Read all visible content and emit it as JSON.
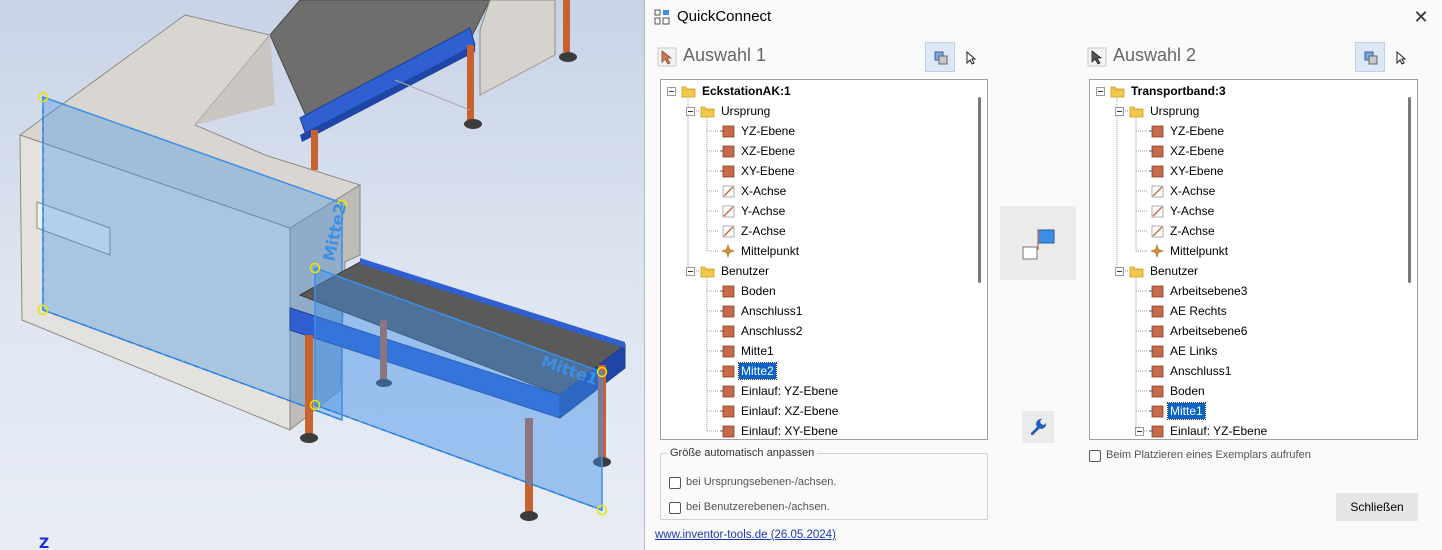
{
  "dialog": {
    "title": "QuickConnect",
    "close_symbol": "✕"
  },
  "viewport": {
    "label_a": "Mitte2",
    "label_b": "Mitte1",
    "axis_label": "Z"
  },
  "left": {
    "heading": "Auswahl 1",
    "tree": [
      {
        "label": "EckstationAK:1",
        "icon": "folder-icon",
        "level": 0,
        "expander": true,
        "bold": true
      },
      {
        "label": "Ursprung",
        "icon": "folder-icon",
        "level": 1,
        "expander": true
      },
      {
        "label": "YZ-Ebene",
        "icon": "plane-icon",
        "level": 2
      },
      {
        "label": "XZ-Ebene",
        "icon": "plane-icon",
        "level": 2
      },
      {
        "label": "XY-Ebene",
        "icon": "plane-icon",
        "level": 2
      },
      {
        "label": "X-Achse",
        "icon": "axis-icon",
        "level": 2
      },
      {
        "label": "Y-Achse",
        "icon": "axis-icon",
        "level": 2
      },
      {
        "label": "Z-Achse",
        "icon": "axis-icon",
        "level": 2
      },
      {
        "label": "Mittelpunkt",
        "icon": "point-icon",
        "level": 2
      },
      {
        "label": "Benutzer",
        "icon": "folder-icon",
        "level": 1,
        "expander": true
      },
      {
        "label": "Boden",
        "icon": "plane-icon",
        "level": 2
      },
      {
        "label": "Anschluss1",
        "icon": "plane-icon",
        "level": 2
      },
      {
        "label": "Anschluss2",
        "icon": "plane-icon",
        "level": 2
      },
      {
        "label": "Mitte1",
        "icon": "plane-icon",
        "level": 2
      },
      {
        "label": "Mitte2",
        "icon": "plane-icon",
        "level": 2,
        "selected": true
      },
      {
        "label": "Einlauf: YZ-Ebene",
        "icon": "plane-icon",
        "level": 2
      },
      {
        "label": "Einlauf: XZ-Ebene",
        "icon": "plane-icon",
        "level": 2
      },
      {
        "label": "Einlauf: XY-Ebene",
        "icon": "plane-icon",
        "level": 2
      }
    ]
  },
  "right": {
    "heading": "Auswahl 2",
    "tree": [
      {
        "label": "Transportband:3",
        "icon": "folder-icon",
        "level": 0,
        "expander": true,
        "bold": true
      },
      {
        "label": "Ursprung",
        "icon": "folder-icon",
        "level": 1,
        "expander": true
      },
      {
        "label": "YZ-Ebene",
        "icon": "plane-icon",
        "level": 2
      },
      {
        "label": "XZ-Ebene",
        "icon": "plane-icon",
        "level": 2
      },
      {
        "label": "XY-Ebene",
        "icon": "plane-icon",
        "level": 2
      },
      {
        "label": "X-Achse",
        "icon": "axis-icon",
        "level": 2
      },
      {
        "label": "Y-Achse",
        "icon": "axis-icon",
        "level": 2
      },
      {
        "label": "Z-Achse",
        "icon": "axis-icon",
        "level": 2
      },
      {
        "label": "Mittelpunkt",
        "icon": "point-icon",
        "level": 2
      },
      {
        "label": "Benutzer",
        "icon": "folder-icon",
        "level": 1,
        "expander": true
      },
      {
        "label": "Arbeitsebene3",
        "icon": "plane-icon",
        "level": 2
      },
      {
        "label": "AE Rechts",
        "icon": "plane-icon",
        "level": 2
      },
      {
        "label": "Arbeitsebene6",
        "icon": "plane-icon",
        "level": 2
      },
      {
        "label": "AE Links",
        "icon": "plane-icon",
        "level": 2
      },
      {
        "label": "Anschluss1",
        "icon": "plane-icon",
        "level": 2
      },
      {
        "label": "Boden",
        "icon": "plane-icon",
        "level": 2
      },
      {
        "label": "Mitte1",
        "icon": "plane-icon",
        "level": 2,
        "selected": true
      },
      {
        "label": "Einlauf: YZ-Ebene",
        "icon": "plane-icon",
        "level": 2,
        "expander": true
      }
    ]
  },
  "auto_size": {
    "legend": "Größe automatisch anpassen",
    "option1": "bei Ursprungsebenen-/achsen.",
    "option2": "bei Benutzerebenen-/achsen."
  },
  "on_place_option": "Beim Platzieren eines Exemplars aufrufen",
  "footer": {
    "link": "www.inventor-tools.de (26.05.2024)",
    "close_button": "Schließen"
  },
  "colors": {
    "accent": "#0a64c8",
    "plane_icon": "#c76a4a",
    "folder_icon": "#f2c94c",
    "highlight_plane": "#3d8fe6"
  }
}
